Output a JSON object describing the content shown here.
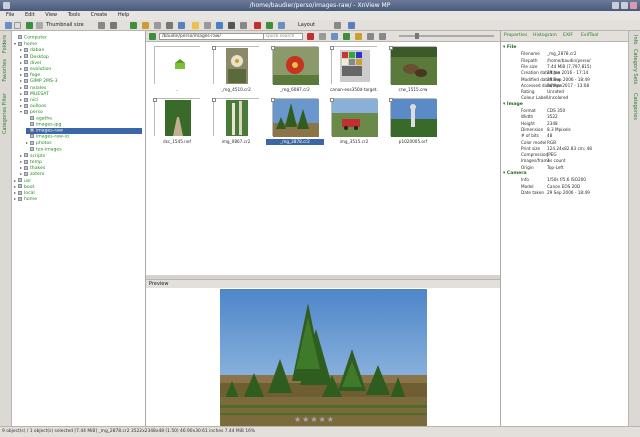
{
  "window": {
    "title": "/home/baudier/perso/images-raw/ - XnView MP"
  },
  "menu": [
    "File",
    "Edit",
    "View",
    "Tools",
    "Create",
    "Help"
  ],
  "toolbar": {
    "view_label": "Thumbnail size",
    "layout_label": "Layout"
  },
  "left_tabs": [
    "Folders",
    "Favorites",
    "Categories Filter"
  ],
  "tree": [
    {
      "label": "Computer",
      "exp": "",
      "sel": false
    },
    {
      "label": "home",
      "exp": "▾",
      "sel": false
    },
    {
      "label": "daban",
      "exp": "▸",
      "sel": false
    },
    {
      "label": "Desktop",
      "exp": "▸",
      "sel": false
    },
    {
      "label": "divel",
      "exp": "▸",
      "sel": false
    },
    {
      "label": "evolution",
      "exp": "▸",
      "sel": false
    },
    {
      "label": "foge",
      "exp": "▸",
      "sel": false
    },
    {
      "label": "GIMP 2MS-3",
      "exp": "▸",
      "sel": false
    },
    {
      "label": "nxlales",
      "exp": "▸",
      "sel": false
    },
    {
      "label": "MUESAT",
      "exp": "▸",
      "sel": false
    },
    {
      "label": "nici",
      "exp": "▸",
      "sel": false
    },
    {
      "label": "oulloos",
      "exp": "▸",
      "sel": false
    },
    {
      "label": "perso",
      "exp": "▾",
      "sel": false
    },
    {
      "label": "agathe",
      "exp": "",
      "sel": false
    },
    {
      "label": "images-jpg",
      "exp": "",
      "sel": false
    },
    {
      "label": "images-raw",
      "exp": "",
      "sel": true
    },
    {
      "label": "images-raw-ici",
      "exp": "",
      "sel": false
    },
    {
      "label": "photos",
      "exp": "▸",
      "sel": false
    },
    {
      "label": "tex-images",
      "exp": "",
      "sel": false
    },
    {
      "label": "scripts",
      "exp": "▸",
      "sel": false
    },
    {
      "label": "temp",
      "exp": "▸",
      "sel": false
    },
    {
      "label": "thakes",
      "exp": "▸",
      "sel": false
    },
    {
      "label": "zotero",
      "exp": "▸",
      "sel": false
    },
    {
      "label": "usr",
      "exp": "▸",
      "sel": false
    },
    {
      "label": "boot",
      "exp": "▸",
      "sel": false
    },
    {
      "label": "local",
      "exp": "▸",
      "sel": false
    },
    {
      "label": "home",
      "exp": "▸",
      "sel": false
    }
  ],
  "browser": {
    "path": "/baudin/perso/images-raw/",
    "search_placeholder": "Quick search",
    "thumbs": [
      {
        "cap": "..",
        "kind": "parent",
        "sel": false
      },
      {
        "cap": "_mg_4510.cr2",
        "kind": "flower1",
        "sel": false
      },
      {
        "cap": "_mg_6087.cr2",
        "kind": "redflower",
        "sel": false
      },
      {
        "cap": "canon-eos350d-target.",
        "kind": "target",
        "sel": false
      },
      {
        "cap": "crw_1515.crw",
        "kind": "animals",
        "sel": false
      },
      {
        "cap": "dsc_1545.nef",
        "kind": "gardenpath",
        "sel": false
      },
      {
        "cap": "img_0867.cr2",
        "kind": "bamboo",
        "sel": false
      },
      {
        "cap": "_mg_2878.cr2",
        "kind": "pines",
        "sel": true
      },
      {
        "cap": "img_3515.cr2",
        "kind": "redcar",
        "sel": false
      },
      {
        "cap": "p1020005.orf",
        "kind": "statue",
        "sel": false
      }
    ]
  },
  "preview": {
    "label": "Preview",
    "rating": "★★★★★"
  },
  "properties": {
    "tabs": [
      "Properties",
      "Histogram",
      "EXIF",
      "ExifTool"
    ],
    "sections": [
      {
        "title": "File",
        "rows": [
          [
            "Filename",
            "_mg_2878.cr2"
          ],
          [
            "Filepath",
            "/home/baudin/perso/"
          ],
          [
            "File size",
            "7.44 MiB (7,797,815)"
          ],
          [
            "Creation date/time",
            "29 Jan 2016 - 17:14"
          ],
          [
            "Modified date/time",
            "29 Sep 2006 - 18:49"
          ],
          [
            "Accessed date/time",
            "24 Apr 2017 - 13:08"
          ],
          [
            "Rating",
            "Unrated"
          ],
          [
            "Colour Label",
            "Uncolored"
          ]
        ]
      },
      {
        "title": "Image",
        "rows": [
          [
            "Format",
            "CDS 350"
          ],
          [
            "Width",
            "3522"
          ],
          [
            "Height",
            "2348"
          ],
          [
            "Dimension",
            "8.3 Mpixels"
          ],
          [
            "# of bits",
            "48"
          ],
          [
            "Color model",
            "RGB"
          ],
          [
            "Print size",
            "124.24x82.83 cm; 48"
          ],
          [
            "Compression",
            "JPEG"
          ],
          [
            "Images/frames count",
            "1"
          ],
          [
            "Origin",
            "Top-Left"
          ]
        ]
      },
      {
        "title": "Camera",
        "rows": [
          [
            "Info",
            "1/50s f/5.6 ISO200"
          ],
          [
            "Model",
            "Canon EOS 20D"
          ],
          [
            "Date taken",
            "29 Sep 2006 - 18:49"
          ]
        ]
      }
    ]
  },
  "right_tabs": [
    "Info",
    "Category Sets",
    "Categories"
  ],
  "status": "9 object(s) / 1 object(s) selected [7.44 MiB]   _mg_2878.cr2   3522x2348x48 (1.50)   46.90x30.61 inches   7.44 MiB   16%"
}
